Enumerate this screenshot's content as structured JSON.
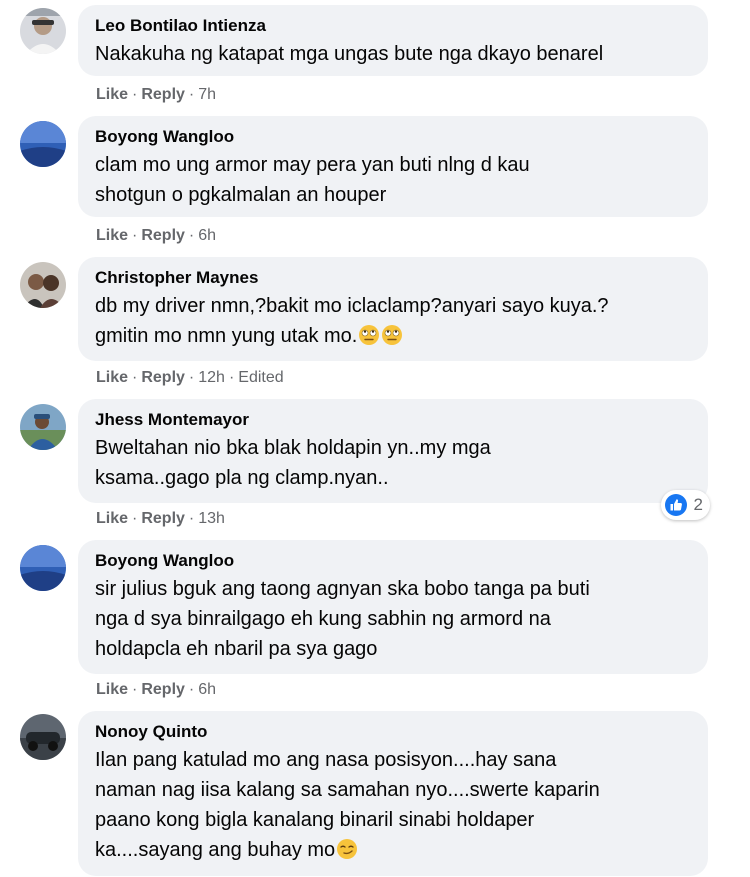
{
  "comments": [
    {
      "author": "Leo Bontilao Intienza",
      "text": "Nakakuha ng katapat mga ungas bute nga dkayo benarel",
      "like": "Like",
      "reply": "Reply",
      "time": "7h"
    },
    {
      "author": "Boyong Wangloo",
      "text": "clam mo ung armor may pera yan buti nlng d kau\nshotgun o pgkalmalan an houper",
      "like": "Like",
      "reply": "Reply",
      "time": "6h"
    },
    {
      "author": "Christopher Maynes",
      "text": "db my driver nmn,?bakit mo iclaclamp?anyari sayo kuya.?\ngmitin mo nmn yung utak mo.",
      "like": "Like",
      "reply": "Reply",
      "time": "12h",
      "edited": "Edited"
    },
    {
      "author": "Jhess Montemayor",
      "text": "Bweltahan nio bka blak holdapin yn..my mga\nksama..gago pla ng clamp.nyan..",
      "like": "Like",
      "reply": "Reply",
      "time": "13h",
      "reaction_count": "2"
    },
    {
      "author": "Boyong Wangloo",
      "text": "sir julius bguk ang taong agnyan ska bobo tanga pa buti\nnga d sya binrailgago eh kung sabhin ng armord na\nholdapcla eh nbaril pa sya gago",
      "like": "Like",
      "reply": "Reply",
      "time": "6h"
    },
    {
      "author": "Nonoy Quinto",
      "text": "Ilan pang katulad mo ang nasa posisyon....hay sana\nnaman nag iisa kalang sa samahan nyo....swerte kaparin\npaano kong bigla kanalang binaril sinabi holdaper\nka....sayang ang buhay mo"
    }
  ],
  "colors": {
    "bubble": "#f0f2f5",
    "meta": "#65676b",
    "like_blue": "#1877f2"
  },
  "icons": {
    "eyeroll_emoji": "face-with-rolling-eyes-emoji",
    "smirk_emoji": "smirking-face-emoji",
    "like_reaction": "thumbs-up-icon"
  }
}
